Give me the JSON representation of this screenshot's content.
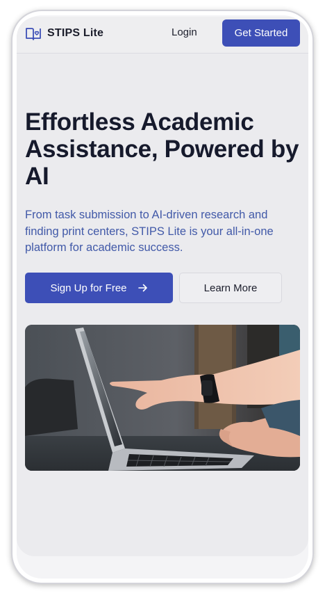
{
  "header": {
    "brand_name": "STIPS Lite",
    "brand_icon": "book-heart-icon",
    "login_label": "Login",
    "get_started_label": "Get Started"
  },
  "hero": {
    "title": "Effortless Academic Assistance, Powered by AI",
    "subtitle": "From task submission to AI-driven research and finding print centers, STIPS Lite is your all-in-one platform for academic success.",
    "signup_label": "Sign Up for Free",
    "learn_more_label": "Learn More",
    "image_icon": "laptop-hands-photo"
  },
  "system_nav": {
    "recents_icon": "recents-icon",
    "home_icon": "home-icon",
    "back_icon": "back-icon"
  },
  "colors": {
    "accent": "#3d4fb7",
    "title": "#161a2c",
    "subtitle": "#4159a8",
    "background": "#ebebee"
  }
}
